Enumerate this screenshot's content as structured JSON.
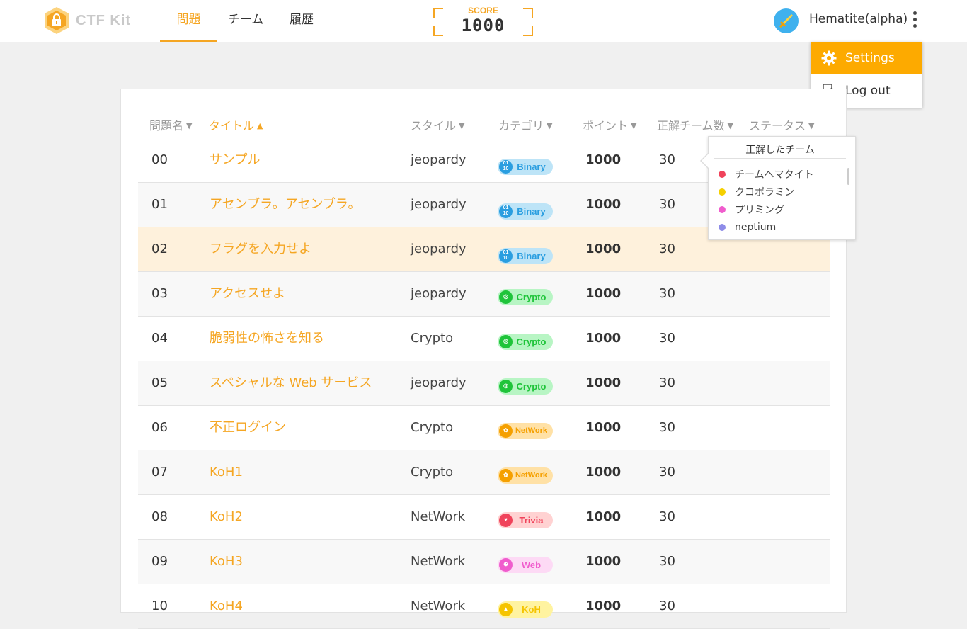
{
  "header": {
    "logo_text": "CTF Kit",
    "tabs": [
      {
        "label": "問題",
        "active": true
      },
      {
        "label": "チーム",
        "active": false
      },
      {
        "label": "履歴",
        "active": false
      }
    ],
    "score_label": "SCORE",
    "score_value": "1000",
    "username": "Hematite(alpha)"
  },
  "user_menu": {
    "items": [
      {
        "label": "Settings",
        "icon": "gear-icon",
        "selected": true
      },
      {
        "label": "Log out",
        "icon": "logout-icon",
        "selected": false
      }
    ]
  },
  "table": {
    "headers": {
      "no": "問題名",
      "title": "タイトル",
      "style": "スタイル",
      "category": "カテゴリ",
      "points": "ポイント",
      "solves": "正解チーム数",
      "status": "ステータス"
    },
    "sorted_column": "title",
    "rows": [
      {
        "no": "00",
        "title": "サンプル",
        "style": "jeopardy",
        "category": "Binary",
        "cat_class": "binary",
        "points": "1000",
        "solves": "30"
      },
      {
        "no": "01",
        "title": "アセンブラ。アセンブラ。",
        "style": "jeopardy",
        "category": "Binary",
        "cat_class": "binary",
        "points": "1000",
        "solves": "30"
      },
      {
        "no": "02",
        "title": "フラグを入力せよ",
        "style": "jeopardy",
        "category": "Binary",
        "cat_class": "binary",
        "points": "1000",
        "solves": "30"
      },
      {
        "no": "03",
        "title": "アクセスせよ",
        "style": "jeopardy",
        "category": "Crypto",
        "cat_class": "crypto",
        "points": "1000",
        "solves": "30"
      },
      {
        "no": "04",
        "title": "脆弱性の怖さを知る",
        "style": "Crypto",
        "category": "Crypto",
        "cat_class": "crypto",
        "points": "1000",
        "solves": "30"
      },
      {
        "no": "05",
        "title": "スペシャルな Web サービス",
        "style": "jeopardy",
        "category": "Crypto",
        "cat_class": "crypto",
        "points": "1000",
        "solves": "30"
      },
      {
        "no": "06",
        "title": "不正ログイン",
        "style": "Crypto",
        "category": "NetWork",
        "cat_class": "network",
        "points": "1000",
        "solves": "30"
      },
      {
        "no": "07",
        "title": "KoH1",
        "style": "Crypto",
        "category": "NetWork",
        "cat_class": "network",
        "points": "1000",
        "solves": "30"
      },
      {
        "no": "08",
        "title": "KoH2",
        "style": "NetWork",
        "category": "Trivia",
        "cat_class": "trivia",
        "points": "1000",
        "solves": "30"
      },
      {
        "no": "09",
        "title": "KoH3",
        "style": "NetWork",
        "category": "Web",
        "cat_class": "web",
        "points": "1000",
        "solves": "30"
      },
      {
        "no": "10",
        "title": "KoH4",
        "style": "NetWork",
        "category": "KoH",
        "cat_class": "koh",
        "points": "1000",
        "solves": "30"
      }
    ]
  },
  "solved_popover": {
    "title": "正解したチーム",
    "teams": [
      {
        "name": "チームヘマタイト",
        "color": "#f0435b"
      },
      {
        "name": "クコポラミン",
        "color": "#f5d000"
      },
      {
        "name": "プリミング",
        "color": "#f05ccd"
      },
      {
        "name": "neptium",
        "color": "#8e8ce8"
      }
    ]
  },
  "colors": {
    "accent": "#f5a623",
    "menu_selected": "#fdaa00",
    "highlight_row": "#fef1dc"
  }
}
